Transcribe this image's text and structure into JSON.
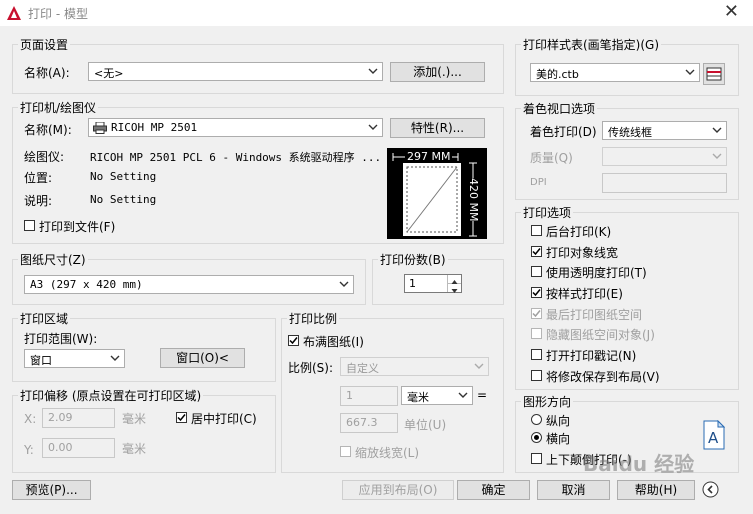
{
  "window": {
    "title": "打印 - 模型",
    "close_glyph": "✕"
  },
  "page_setup": {
    "group_title": "页面设置",
    "name_label": "名称(A):",
    "name_value": "<无>",
    "add_button": "添加(.)..."
  },
  "printer": {
    "group_title": "打印机/绘图仪",
    "name_label": "名称(M):",
    "name_value": "RICOH MP 2501",
    "properties_button": "特性(R)...",
    "plotter_label": "绘图仪:",
    "plotter_value": "RICOH MP 2501 PCL 6 - Windows 系统驱动程序 ...",
    "location_label": "位置:",
    "location_value": "No Setting",
    "description_label": "说明:",
    "description_value": "No Setting",
    "print_to_file_label": "打印到文件(F)",
    "print_to_file_checked": false,
    "preview_width_text": "297 MM",
    "preview_height_text": "420 MM"
  },
  "paper_size": {
    "group_title": "图纸尺寸(Z)",
    "value": "A3 (297 x 420 mm)"
  },
  "copies": {
    "group_title": "打印份数(B)",
    "value": "1"
  },
  "plot_area": {
    "group_title": "打印区域",
    "range_label": "打印范围(W):",
    "range_value": "窗口",
    "window_button": "窗口(O)<"
  },
  "plot_offset": {
    "group_title": "打印偏移 (原点设置在可打印区域)",
    "x_label": "X:",
    "x_value": "2.09",
    "x_unit": "毫米",
    "y_label": "Y:",
    "y_value": "0.00",
    "y_unit": "毫米",
    "center_label": "居中打印(C)",
    "center_checked": true
  },
  "plot_scale": {
    "group_title": "打印比例",
    "fit_label": "布满图纸(I)",
    "fit_checked": true,
    "scale_label": "比例(S):",
    "scale_value": "自定义",
    "value1": "1",
    "unit1": "毫米",
    "equals": "=",
    "value2": "667.3",
    "unit2": "单位(U)",
    "lineweight_label": "缩放线宽(L)",
    "lineweight_checked": false
  },
  "plot_style_table": {
    "group_title": "打印样式表(画笔指定)(G)",
    "value": "美的.ctb"
  },
  "shaded_viewport": {
    "group_title": "着色视口选项",
    "shade_label": "着色打印(D)",
    "shade_value": "传统线框",
    "quality_label": "质量(Q)",
    "quality_value": "",
    "dpi_label": "DPI",
    "dpi_value": ""
  },
  "plot_options": {
    "group_title": "打印选项",
    "items": [
      {
        "label": "后台打印(K)",
        "checked": false,
        "disabled": false
      },
      {
        "label": "打印对象线宽",
        "checked": true,
        "disabled": false
      },
      {
        "label": "使用透明度打印(T)",
        "checked": false,
        "disabled": false
      },
      {
        "label": "按样式打印(E)",
        "checked": true,
        "disabled": false
      },
      {
        "label": "最后打印图纸空间",
        "checked": true,
        "disabled": true
      },
      {
        "label": "隐藏图纸空间对象(J)",
        "checked": false,
        "disabled": true
      },
      {
        "label": "打开打印戳记(N)",
        "checked": false,
        "disabled": false
      },
      {
        "label": "将修改保存到布局(V)",
        "checked": false,
        "disabled": false
      }
    ]
  },
  "orientation": {
    "group_title": "图形方向",
    "portrait_label": "纵向",
    "portrait_selected": false,
    "landscape_label": "横向",
    "landscape_selected": true,
    "upside_down_label": "上下颠倒打印(-)",
    "upside_down_checked": false,
    "preview_letter": "A"
  },
  "footer": {
    "preview_button": "预览(P)...",
    "apply_button": "应用到布局(O)",
    "ok_button": "确定",
    "cancel_button": "取消",
    "help_button": "帮助(H)"
  },
  "watermark": "Baidu 经验",
  "colors": {
    "accent_red": "#c8102e",
    "checkmark": "#000000",
    "disabled_text": "#a0a0a0"
  }
}
